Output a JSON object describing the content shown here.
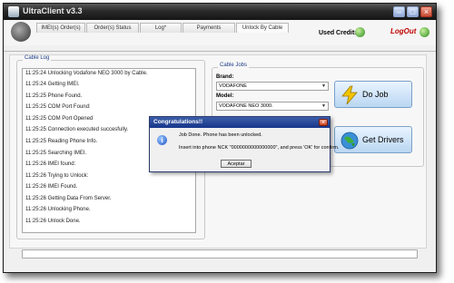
{
  "window": {
    "title": "UltraClient v3.3"
  },
  "tabs": [
    {
      "label": "IMEI(s) Order(s)"
    },
    {
      "label": "Order(s) Status"
    },
    {
      "label": "Log*"
    },
    {
      "label": "Payments"
    },
    {
      "label": "Unlock By Cable",
      "active": true
    }
  ],
  "header": {
    "used_credits_label": "Used Credits]",
    "logout_label": "LogOut"
  },
  "cable_log": {
    "title": "Cable Log",
    "lines": [
      "11:25:24 Unlocking Vodafone NEO 3000 by Cable.",
      "11:25:24 Getting IMEI.",
      "11:25:25 Phone Found.",
      "11:25:25 COM Port Found:",
      "11:25:25 COM Port Opened",
      "11:25:25 Connection executed succesfully.",
      "11:25:25 Reading Phone Info.",
      "11:25:25 Searching IMEI.",
      "11:25:26 IMEI found:",
      "11:25:26 Trying to Unlock:",
      "11:25:26 IMEI Found.",
      "11:25:26 Getting Data From Server.",
      "11:25:26 Unlocking Phone.",
      "11:25:26 Unlock Done."
    ]
  },
  "cable_jobs": {
    "title": "Cable Jobs",
    "brand_label": "Brand:",
    "brand_value": "VODAFONE",
    "model_label": "Model:",
    "model_value": "VODAFONE NEO 3000.",
    "do_job_label": "Do Job",
    "get_drivers_label": "Get Drivers"
  },
  "dialog": {
    "title": "Congratulations!!",
    "message1": "Job Done. Phone has been unlocked.",
    "message2": "Insert into phone NCK \"0000000000000000\", and press 'OK' for confirm.",
    "ok_label": "Aceptar"
  },
  "colors": {
    "title_bar": "#2a2a2a",
    "dialog_title": "#15358a",
    "logout": "#c00000"
  },
  "icons": [
    "app-icon",
    "logo-icon",
    "credits-icon",
    "logout-icon",
    "lightning-icon",
    "globe-icon",
    "info-icon",
    "close-icon"
  ]
}
